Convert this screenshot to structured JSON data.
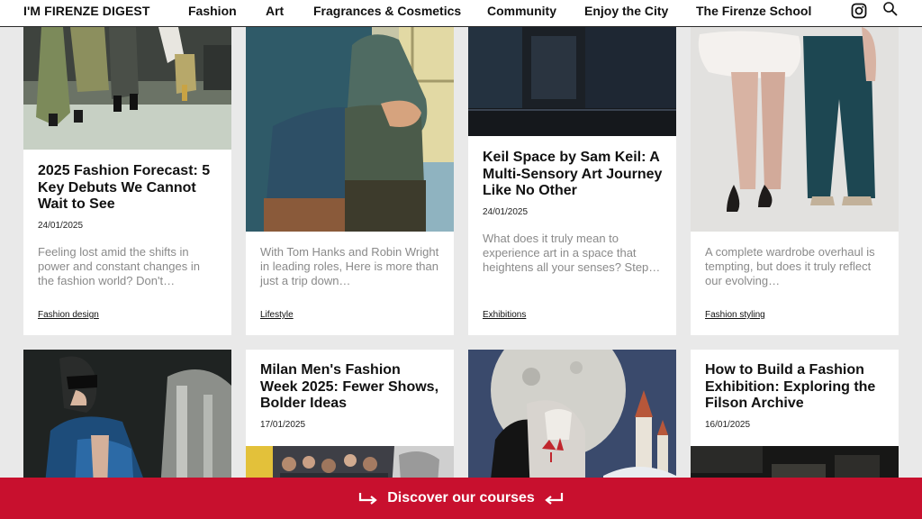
{
  "header": {
    "brand": "I'M FIRENZE DIGEST",
    "nav": [
      "Fashion",
      "Art",
      "Fragrances & Cosmetics",
      "Community",
      "Enjoy the City",
      "The Firenze School"
    ],
    "icons": [
      "instagram-icon",
      "search-icon"
    ]
  },
  "cards": [
    {
      "title": "2025 Fashion Forecast: 5 Key Debuts We Cannot Wait to See",
      "date": "24/01/2025",
      "excerpt": "Feeling lost amid the shifts in power and constant changes in the fashion world? Don't…",
      "category": "Fashion design"
    },
    {
      "title": "",
      "date": "",
      "excerpt": "With Tom Hanks and Robin Wright in leading roles, Here is more than just a trip down…",
      "category": "Lifestyle"
    },
    {
      "title": "Keil Space by Sam Keil: A Multi-Sensory Art Journey Like No Other",
      "date": "24/01/2025",
      "excerpt": "What does it truly mean to experience art in a space that heightens all your senses? Step…",
      "category": "Exhibitions"
    },
    {
      "title": "",
      "date": "",
      "excerpt": "A complete wardrobe overhaul is tempting, but does it truly reflect our evolving…",
      "category": "Fashion styling"
    },
    {
      "title": "Milan Men's Fashion Week 2025: Fewer Shows, Bolder Ideas",
      "date": "17/01/2025"
    },
    {
      "title": "How to Build a Fashion Exhibition: Exploring the Filson Archive",
      "date": "16/01/2025"
    }
  ],
  "cta": {
    "label": "Discover our courses"
  },
  "colors": {
    "accent": "#c8102e",
    "background": "#e9e9e9",
    "card": "#ffffff",
    "excerpt": "#8a8a8a"
  }
}
